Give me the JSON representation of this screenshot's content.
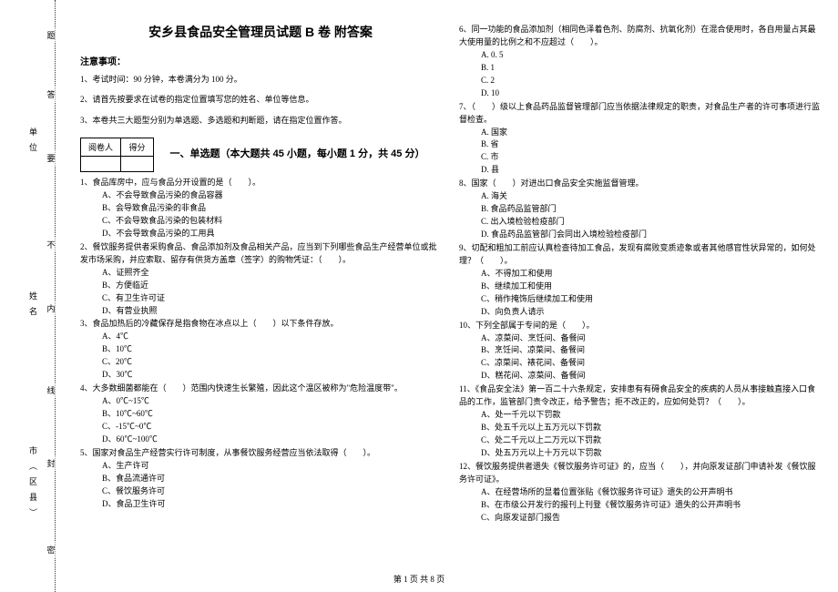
{
  "title": "安乡县食品安全管理员试题 B 卷 附答案",
  "notice_head": "注意事项：",
  "instructions": [
    "1、考试时间：90 分钟，本卷满分为 100 分。",
    "2、请首先按要求在试卷的指定位置填写您的姓名、单位等信息。",
    "3、本卷共三大题型分别为单选题、多选题和判断题，请在指定位置作答。"
  ],
  "score_table": {
    "h1": "阅卷人",
    "h2": "得分"
  },
  "part1_title": "一、单选题（本大题共 45 小题，每小题 1 分，共 45 分）",
  "left_questions": [
    {
      "q": "1、食品库房中，应与食品分开设置的是（　　）。",
      "opts": [
        "A、不会导致食品污染的食品容器",
        "B、会导致食品污染的非食品",
        "C、不会导致食品污染的包装材料",
        "D、不会导致食品污染的工用具"
      ]
    },
    {
      "q": "2、餐饮服务提供者采购食品、食品添加剂及食品相关产品，应当到下列哪些食品生产经营单位或批发市场采购，并应索取、留存有供货方盖章（签字）的购物凭证：（　　）。",
      "opts": [
        "A、证照齐全",
        "B、方便临近",
        "C、有卫生许可证",
        "D、有营业执照"
      ]
    },
    {
      "q": "3、食品加热后的冷藏保存是指食物在冰点以上（　　）以下条件存放。",
      "opts": [
        "A、4℃",
        "B、10℃",
        "C、20℃",
        "D、30℃"
      ]
    },
    {
      "q": "4、大多数细菌都能在（　　）范围内快速生长繁殖，因此这个温区被称为\"危险温度带\"。",
      "opts": [
        "A、0℃~15℃",
        "B、10℃~60℃",
        "C、-15℃~0℃",
        "D、60℃~100℃"
      ]
    },
    {
      "q": "5、国家对食品生产经营实行许可制度，从事餐饮服务经营应当依法取得（　　）。",
      "opts": [
        "A、生产许可",
        "B、食品流通许可",
        "C、餐饮服务许可",
        "D、食品卫生许可"
      ]
    }
  ],
  "right_questions": [
    {
      "q": "6、同一功能的食品添加剂（相同色泽着色剂、防腐剂、抗氧化剂）在混合使用时，各自用量占其最大使用量的比例之和不应超过（　　）。",
      "opts": [
        "A. 0. 5",
        "B. 1",
        "C. 2",
        "D. 10"
      ]
    },
    {
      "q": "7、（　　）级以上食品药品监督管理部门应当依据法律规定的职责，对食品生产者的许可事项进行监督检查。",
      "opts": [
        "A. 国家",
        "B. 省",
        "C. 市",
        "D. 县"
      ]
    },
    {
      "q": "8、国家（　　）对进出口食品安全实施监督管理。",
      "opts": [
        "A. 海关",
        "B. 食品药品监管部门",
        "C. 出入境检验检疫部门",
        "D. 食品药品监管部门会同出入境检验检疫部门"
      ]
    },
    {
      "q": "9、切配和粗加工前应认真检查待加工食品，发现有腐败变质迹象或者其他感官性状异常的，如何处理？（　　）。",
      "opts": [
        "A、不得加工和使用",
        "B、继续加工和使用",
        "C、稍作掩饰后继续加工和使用",
        "D、向负责人请示"
      ]
    },
    {
      "q": "10、下列全部属于专间的是（　　）。",
      "opts": [
        "A、凉菜间、烹饪间、备餐间",
        "B、烹饪间、凉菜间、备餐间",
        "C、凉菜间、裱花间、备餐间",
        "D、糕花间、凉菜间、备餐间"
      ]
    },
    {
      "q": "11、《食品安全法》第一百二十六条规定，安排患有有碍食品安全的疾病的人员从事接触直接入口食品的工作，监管部门责令改正，给予警告；拒不改正的，应如何处罚？（　　）。",
      "opts": [
        "A、处一千元以下罚款",
        "B、处五千元以上五万元以下罚款",
        "C、处二千元以上二万元以下罚款",
        "D、处五万元以上十万元以下罚款"
      ]
    },
    {
      "q": "12、餐饮服务提供者遗失《餐饮服务许可证》的，应当（　　），并向原发证部门申请补发《餐饮服务许可证》。",
      "opts": [
        "A、在经营场所的显着位置张贴《餐饮服务许可证》遗失的公开声明书",
        "B、在市级公开发行的报刊上刊登《餐饮服务许可证》遗失的公开声明书",
        "C、向原发证部门报告"
      ]
    }
  ],
  "binding_labels": {
    "city": "市（区县）",
    "name": "姓名",
    "unit": "单位"
  },
  "binding_chars": {
    "mi": "密",
    "feng": "封",
    "xian": "线",
    "nei": "内",
    "bu": "不",
    "yao": "要",
    "da": "答",
    "ti": "题"
  },
  "footer": "第 1 页 共 8 页"
}
